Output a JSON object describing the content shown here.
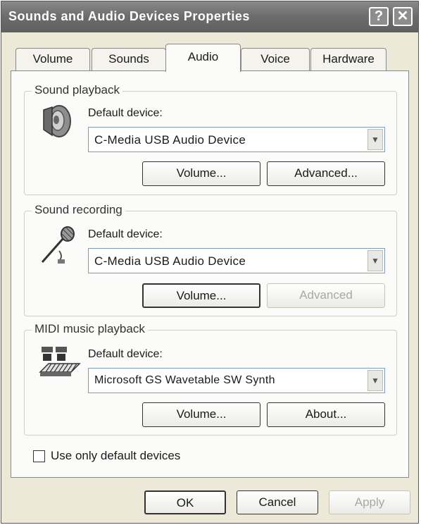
{
  "window": {
    "title": "Sounds and Audio Devices Properties",
    "help_glyph": "?",
    "close_glyph": "✕"
  },
  "tabs": [
    {
      "label": "Volume",
      "active": false
    },
    {
      "label": "Sounds",
      "active": false
    },
    {
      "label": "Audio",
      "active": true
    },
    {
      "label": "Voice",
      "active": false
    },
    {
      "label": "Hardware",
      "active": false
    }
  ],
  "groups": {
    "playback": {
      "title": "Sound playback",
      "icon": "speaker-icon",
      "device_label": "Default device:",
      "device": "C-Media USB Audio Device",
      "volume_button": "Volume...",
      "advanced_button": "Advanced..."
    },
    "recording": {
      "title": "Sound recording",
      "icon": "microphone-icon",
      "device_label": "Default device:",
      "device": "C-Media USB Audio Device",
      "volume_button": "Volume...",
      "advanced_button": "Advanced",
      "advanced_disabled": true
    },
    "midi": {
      "title": "MIDI music playback",
      "icon": "midi-keyboard-icon",
      "device_label": "Default device:",
      "device": "Microsoft GS Wavetable SW Synth",
      "volume_button": "Volume...",
      "about_button": "About..."
    }
  },
  "use_default_only": {
    "label": "Use only default devices",
    "checked": false
  },
  "buttons": {
    "ok": "OK",
    "cancel": "Cancel",
    "apply": "Apply",
    "apply_disabled": true
  }
}
